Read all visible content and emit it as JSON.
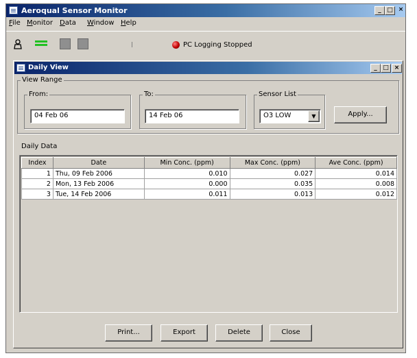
{
  "app": {
    "title": "Aeroqual Sensor Monitor"
  },
  "menu": [
    "File",
    "Monitor",
    "Data",
    "Window",
    "Help"
  ],
  "status": {
    "text": "PC Logging Stopped"
  },
  "daily_view": {
    "title": "Daily View",
    "view_range_label": "View Range",
    "from": {
      "label": "From:",
      "value": "04 Feb 06"
    },
    "to": {
      "label": "To:",
      "value": "14 Feb 06"
    },
    "sensor": {
      "label": "Sensor List",
      "value": "O3 LOW"
    },
    "apply_label": "Apply...",
    "daily_data_label": "Daily Data",
    "columns": [
      "Index",
      "Date",
      "Min Conc. (ppm)",
      "Max Conc. (ppm)",
      "Ave Conc. (ppm)"
    ],
    "rows": [
      [
        "1",
        "Thu, 09 Feb 2006",
        "0.010",
        "0.027",
        "0.014"
      ],
      [
        "2",
        "Mon, 13 Feb 2006",
        "0.000",
        "0.035",
        "0.008"
      ],
      [
        "3",
        "Tue, 14 Feb 2006",
        "0.011",
        "0.013",
        "0.012"
      ]
    ],
    "buttons": {
      "print": "Print...",
      "export": "Export",
      "delete": "Delete",
      "close": "Close"
    }
  },
  "colors": {
    "title_bar": "#0a246a",
    "face": "#d4d0c8",
    "status_indicator": "#c00000",
    "toolbar_green": "#22c022"
  }
}
